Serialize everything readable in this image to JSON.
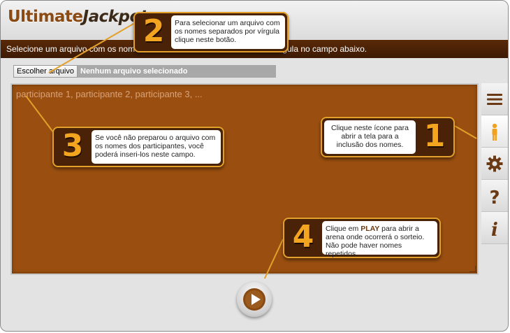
{
  "app": {
    "logo_part1": "Ultimate",
    "logo_part2": "Jackpot"
  },
  "instruction_bar": {
    "text_left": "Selecione um arquivo com os nomes",
    "text_right": "vírgula no campo abaixo."
  },
  "file_input": {
    "button_label": "Escolher arquivo",
    "status": "Nenhum arquivo selecionado"
  },
  "participants_field": {
    "placeholder": "participante 1, participante 2, participante 3, ..."
  },
  "sidebar": {
    "buttons": [
      {
        "icon": "menu-icon"
      },
      {
        "icon": "person-icon"
      },
      {
        "icon": "gear-icon"
      },
      {
        "icon": "help-icon"
      },
      {
        "icon": "info-icon"
      }
    ]
  },
  "colors": {
    "accent": "#e3a02a",
    "panel": "#9a4f10",
    "dark": "#4a2208"
  },
  "callouts": {
    "c1": {
      "number": "1",
      "text": "Clique neste ícone para abrir a tela para a inclusão dos nomes."
    },
    "c2": {
      "number": "2",
      "text": "Para selecionar um arquivo com os nomes separados por vírgula clique neste botão."
    },
    "c3": {
      "number": "3",
      "text": "Se você não preparou o arquivo com os nomes dos participantes, você poderá inseri-los neste campo."
    },
    "c4": {
      "number": "4",
      "text_pre": "Clique em ",
      "text_bold": "PLAY",
      "text_post": " para abrir a arena onde ocorrerá o sorteio. Não pode haver nomes repetidos."
    }
  }
}
